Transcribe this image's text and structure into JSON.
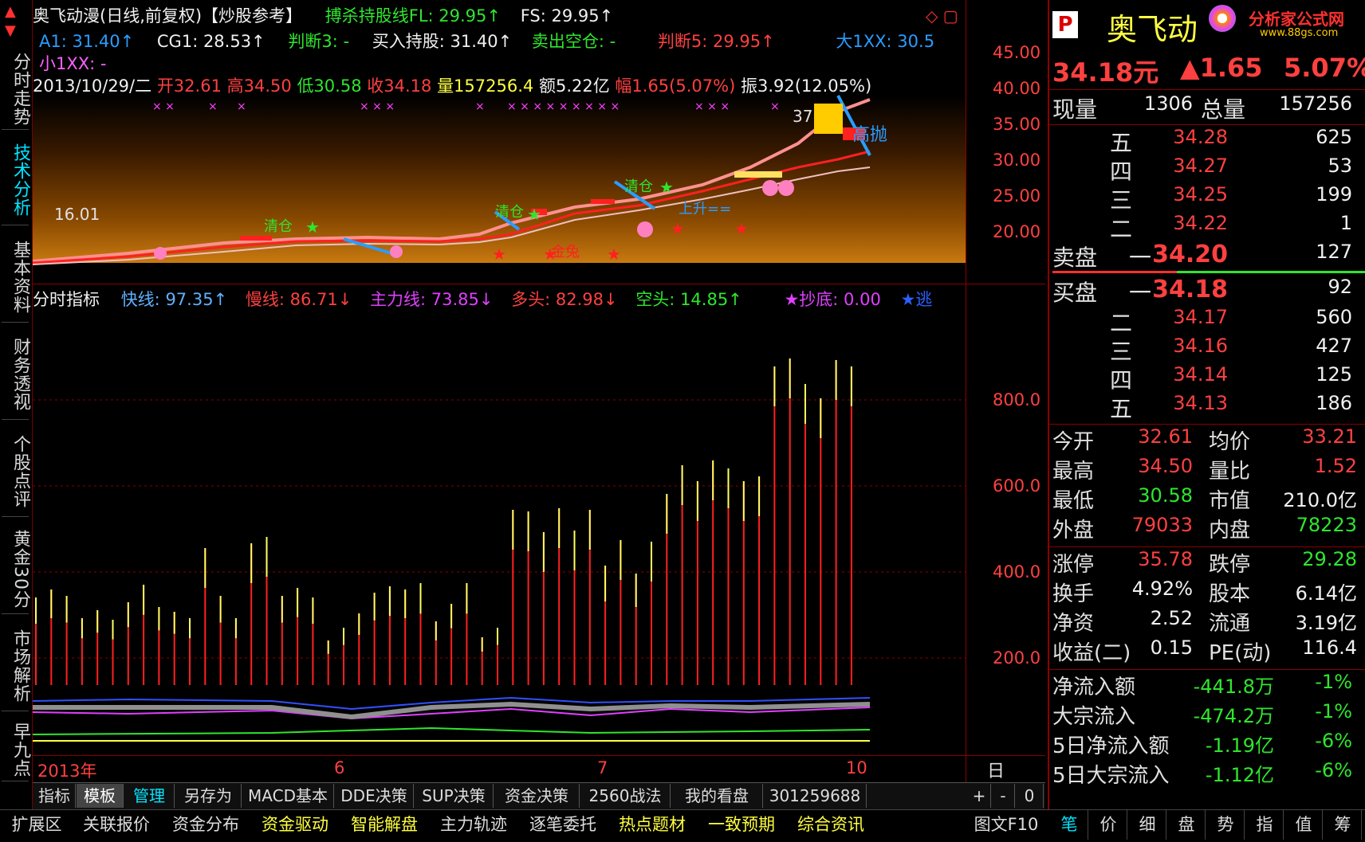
{
  "sidebar": {
    "tabs": [
      {
        "label": "分时走势"
      },
      {
        "label": "技术分析"
      },
      {
        "label": "基本资料"
      },
      {
        "label": "财务透视"
      },
      {
        "label": "个股点评"
      },
      {
        "label": "黄金30分"
      },
      {
        "label": "市场解析"
      },
      {
        "label": "早九点"
      }
    ],
    "up_arrow": "▲",
    "down_arrow": "▼"
  },
  "chart_header": {
    "line1_title": "奥飞动漫(日线,前复权)【炒股参考】",
    "line1_fl": "搏杀持股线FL: 29.95↑",
    "line1_fs": "FS: 29.95↑",
    "line2_a1": "A1: 31.40↑",
    "line2_cg1": "CG1: 28.53↑",
    "line2_pd3": "判断3: -",
    "line2_buy": "买入持股: 31.40↑",
    "line2_sell": "卖出空仓: -",
    "line2_pd5": "判断5: 29.95↑",
    "line2_big": "大1XX: 30.5",
    "line3_small": "小1XX: -",
    "info_date": "2013/10/29/二",
    "info_open": "开32.61",
    "info_high": "高34.50",
    "info_low": "低30.58",
    "info_close": "收34.18",
    "info_vol": "量157256.4",
    "info_amt": "额5.22亿",
    "info_range": "幅1.65(5.07%)",
    "info_amp": "振3.92(12.05%)"
  },
  "price_chart": {
    "label_low": "16.01",
    "label_high": "37.49",
    "annot_gaopao": "高抛",
    "annot_qingcang1": "清仓",
    "annot_qingcang2": "清仓",
    "annot_qingcang3": "清仓",
    "annot_shangsheng": "上升==",
    "annot_jinjia": "金兔",
    "y_ticks": [
      "45.00",
      "40.00",
      "35.00",
      "30.00",
      "25.00",
      "20.00"
    ]
  },
  "indicator_header": {
    "name": "分时指标",
    "fast": "快线: 97.35↑",
    "slow": "慢线: 86.71↓",
    "main": "主力线: 73.85↓",
    "long": "多头: 82.98↓",
    "short": "空头: 14.85↑",
    "bottom": "★抄底: 0.00",
    "escape": "★逃"
  },
  "indicator_chart": {
    "y_ticks": [
      "800.0",
      "600.0",
      "400.0",
      "200.0"
    ],
    "x_labels": [
      "2013年",
      "6",
      "7",
      "10"
    ],
    "period": "日线"
  },
  "toolbar": {
    "items": [
      "指标",
      "模板",
      "管理",
      "另存为",
      "MACD基本",
      "DDE决策",
      "SUP决策",
      "资金决策",
      "2560战法",
      "我的看盘",
      "301259688"
    ],
    "plus": "+",
    "minus": "-",
    "zero": "0"
  },
  "bottom_tabs": {
    "items": [
      "扩展区",
      "关联报价",
      "资金分布",
      "资金驱动",
      "智能解盘",
      "主力轨迹",
      "逐笔委托",
      "热点题材",
      "一致预期",
      "综合资讯"
    ],
    "f10": "图文F10",
    "right_items": [
      "笔",
      "价",
      "细",
      "盘",
      "势",
      "指",
      "值",
      "筹"
    ]
  },
  "quote": {
    "badge": "P",
    "name": "奥飞动",
    "site_name": "分析家公式网",
    "site_url": "www.88gs.com",
    "price": "34.18元",
    "change": "▲1.65",
    "pct": "5.07%",
    "now_vol_lbl": "现量",
    "now_vol": "1306",
    "total_vol_lbl": "总量",
    "total_vol": "157256",
    "sell_lbl": "卖盘",
    "buy_lbl": "买盘",
    "sells": [
      {
        "lvl": "五",
        "price": "34.28",
        "vol": "625"
      },
      {
        "lvl": "四",
        "price": "34.27",
        "vol": "53"
      },
      {
        "lvl": "三",
        "price": "34.25",
        "vol": "199"
      },
      {
        "lvl": "二",
        "price": "34.22",
        "vol": "1"
      },
      {
        "lvl": "一",
        "price": "34.20",
        "vol": "127"
      }
    ],
    "buys": [
      {
        "lvl": "一",
        "price": "34.18",
        "vol": "92"
      },
      {
        "lvl": "二",
        "price": "34.17",
        "vol": "560"
      },
      {
        "lvl": "三",
        "price": "34.16",
        "vol": "427"
      },
      {
        "lvl": "四",
        "price": "34.14",
        "vol": "125"
      },
      {
        "lvl": "五",
        "price": "34.13",
        "vol": "186"
      }
    ],
    "stats": [
      {
        "l1": "今开",
        "v1": "32.61",
        "c1": "red",
        "l2": "均价",
        "v2": "33.21",
        "c2": "red"
      },
      {
        "l1": "最高",
        "v1": "34.50",
        "c1": "red",
        "l2": "量比",
        "v2": "1.52",
        "c2": "red"
      },
      {
        "l1": "最低",
        "v1": "30.58",
        "c1": "green",
        "l2": "市值",
        "v2": "210.0亿",
        "c2": "white"
      },
      {
        "l1": "外盘",
        "v1": "79033",
        "c1": "red",
        "l2": "内盘",
        "v2": "78223",
        "c2": "green"
      }
    ],
    "stats2": [
      {
        "l1": "涨停",
        "v1": "35.78",
        "c1": "red",
        "l2": "跌停",
        "v2": "29.28",
        "c2": "green"
      },
      {
        "l1": "换手",
        "v1": "4.92%",
        "c1": "white",
        "l2": "股本",
        "v2": "6.14亿",
        "c2": "white"
      },
      {
        "l1": "净资",
        "v1": "2.52",
        "c1": "white",
        "l2": "流通",
        "v2": "3.19亿",
        "c2": "white"
      },
      {
        "l1": "收益(二)",
        "v1": "0.15",
        "c1": "white",
        "l2": "PE(动)",
        "v2": "116.4",
        "c2": "white"
      }
    ],
    "flows": [
      {
        "lbl": "净流入额",
        "val": "-441.8万",
        "pct": "-1%"
      },
      {
        "lbl": "大宗流入",
        "val": "-474.2万",
        "pct": "-1%"
      },
      {
        "lbl": "5日净流入额",
        "val": "-1.19亿",
        "pct": "-6%"
      },
      {
        "lbl": "5日大宗流入",
        "val": "-1.12亿",
        "pct": "-6%"
      }
    ]
  },
  "colors": {
    "red": "#ff4040",
    "green": "#2ee62e",
    "grid": "#8b0000",
    "cyan": "#00e5ff"
  }
}
